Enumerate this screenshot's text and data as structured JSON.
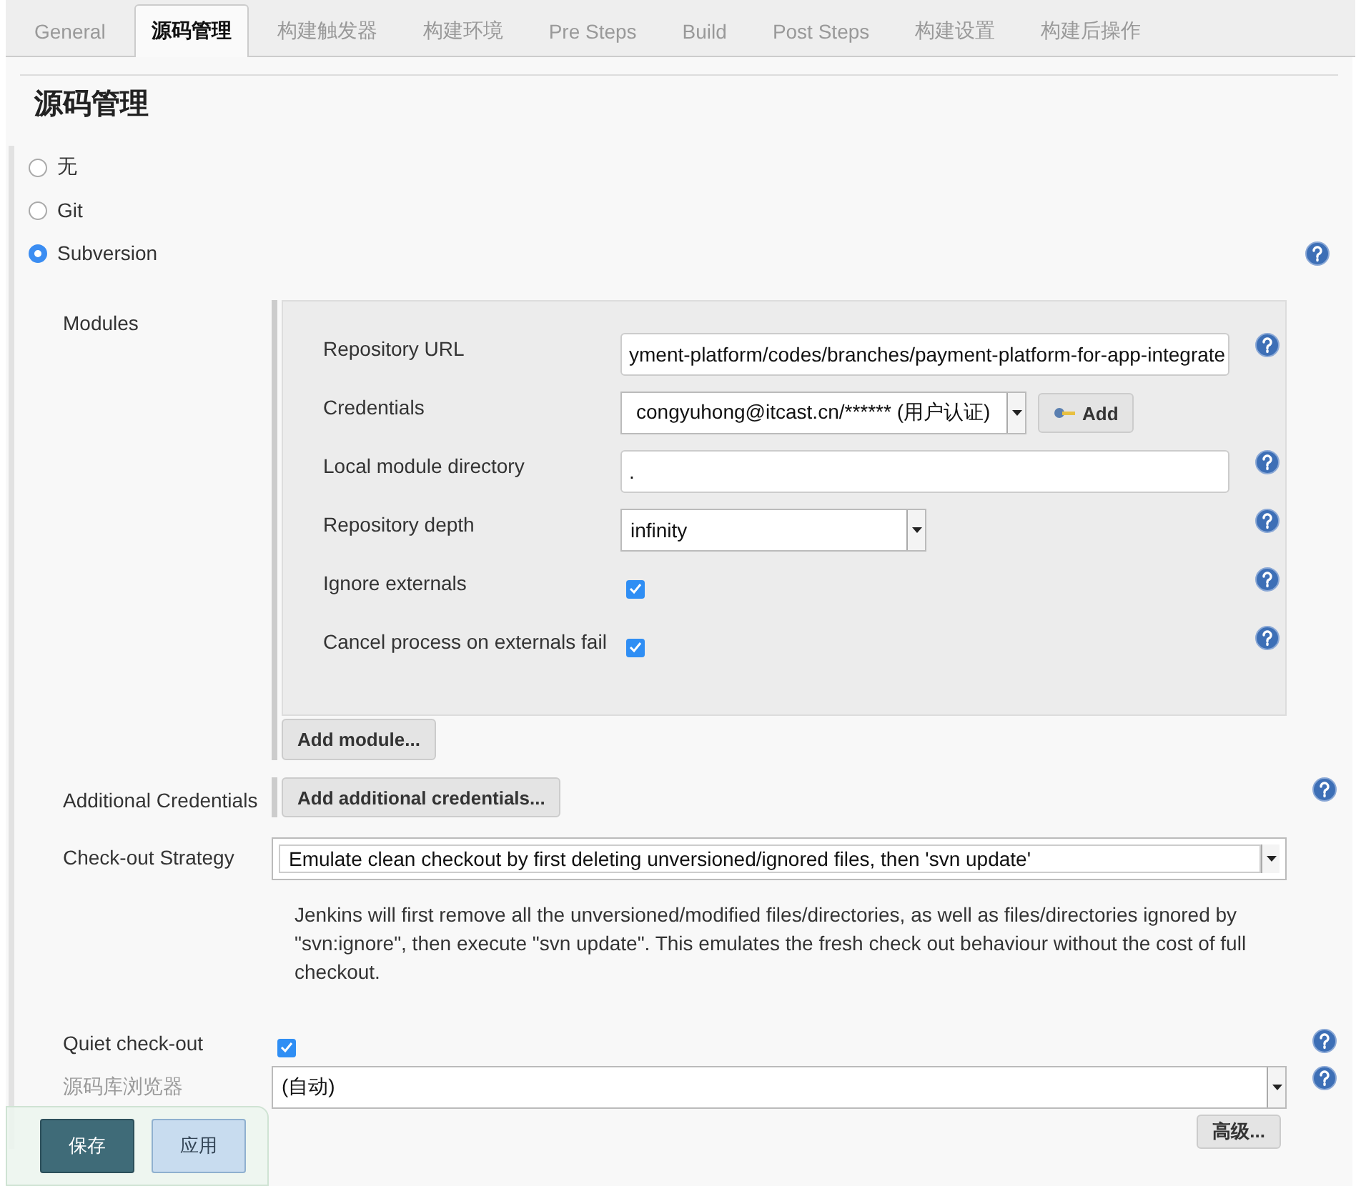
{
  "tabs": [
    {
      "label": "General",
      "selected": false
    },
    {
      "label": "源码管理",
      "selected": true
    },
    {
      "label": "构建触发器",
      "selected": false
    },
    {
      "label": "构建环境",
      "selected": false
    },
    {
      "label": "Pre Steps",
      "selected": false
    },
    {
      "label": "Build",
      "selected": false
    },
    {
      "label": "Post Steps",
      "selected": false
    },
    {
      "label": "构建设置",
      "selected": false
    },
    {
      "label": "构建后操作",
      "selected": false
    }
  ],
  "heading": "源码管理",
  "scm_options": [
    {
      "label": "无",
      "selected": false,
      "help": false
    },
    {
      "label": "Git",
      "selected": false,
      "help": false
    },
    {
      "label": "Subversion",
      "selected": true,
      "help": true
    }
  ],
  "modules": {
    "label": "Modules",
    "fields": [
      {
        "kind": "text",
        "label": "Repository URL",
        "value": "yment-platform/codes/branches/payment-platform-for-app-integrate",
        "help": true
      },
      {
        "kind": "credentials",
        "label": "Credentials",
        "value": "congyuhong@itcast.cn/****** (用户认证)",
        "button": "Add",
        "help": false
      },
      {
        "kind": "text",
        "label": "Local module directory",
        "value": ".",
        "help": true
      },
      {
        "kind": "select",
        "label": "Repository depth",
        "value": "infinity",
        "help": true
      },
      {
        "kind": "checkbox",
        "label": "Ignore externals",
        "checked": true,
        "help": true
      },
      {
        "kind": "checkbox",
        "label": "Cancel process on externals fail",
        "checked": true,
        "help": true
      }
    ],
    "add_button": "Add module..."
  },
  "additional_credentials": {
    "label": "Additional Credentials",
    "button": "Add additional credentials...",
    "help": true
  },
  "checkout_strategy": {
    "label": "Check-out Strategy",
    "value": "Emulate clean checkout by first deleting unversioned/ignored files, then 'svn update'",
    "description": "Jenkins will first remove all the unversioned/modified files/directories, as well as files/directories ignored by \"svn:ignore\", then execute \"svn update\". This emulates the fresh check out behaviour without the cost of full checkout."
  },
  "quiet_checkout": {
    "label": "Quiet check-out",
    "checked": true,
    "help": true
  },
  "repository_browser": {
    "label": "源码库浏览器",
    "value": "(自动)",
    "help": true
  },
  "advanced_button": "高级...",
  "bottom_bar": {
    "save": "保存",
    "apply": "应用"
  }
}
